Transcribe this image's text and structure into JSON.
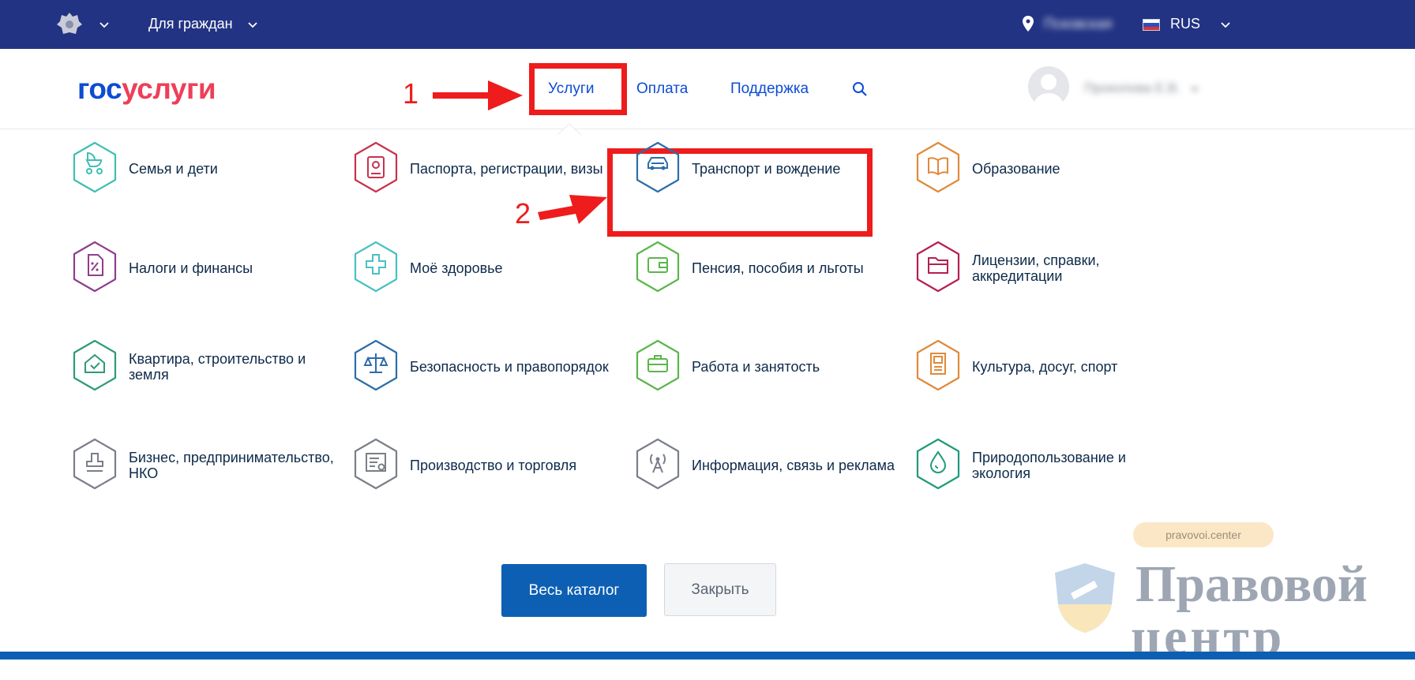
{
  "topbar": {
    "for_citizens": "Для граждан",
    "location": "Псковская",
    "language": "RUS"
  },
  "header": {
    "logo_part1": "гос",
    "logo_part2": "услуги",
    "nav": [
      "Услуги",
      "Оплата",
      "Поддержка"
    ],
    "user_name": "Прокопова Е.В."
  },
  "annotations": {
    "marker1": "1",
    "marker2": "2"
  },
  "catalog": {
    "items": [
      {
        "label": "Семья и дети",
        "icon": "stroller-icon",
        "color": "#3fbfb3"
      },
      {
        "label": "Паспорта, регистрации, визы",
        "icon": "passport-icon",
        "color": "#c8324c"
      },
      {
        "label": "Транспорт и вождение",
        "icon": "car-icon",
        "color": "#2d6da8"
      },
      {
        "label": "Образование",
        "icon": "book-icon",
        "color": "#e08a3a"
      },
      {
        "label": "Налоги и финансы",
        "icon": "tax-document-icon",
        "color": "#8f3e8d"
      },
      {
        "label": "Моё здоровье",
        "icon": "medical-cross-icon",
        "color": "#4ac1c0"
      },
      {
        "label": "Пенсия, пособия и льготы",
        "icon": "wallet-icon",
        "color": "#5bb64b"
      },
      {
        "label": "Лицензии, справки, аккредитации",
        "icon": "folder-icon",
        "color": "#b4204f"
      },
      {
        "label": "Квартира, строительство и земля",
        "icon": "house-icon",
        "color": "#2e9a7a"
      },
      {
        "label": "Безопасность и правопорядок",
        "icon": "scales-icon",
        "color": "#2d6da8"
      },
      {
        "label": "Работа и занятость",
        "icon": "briefcase-icon",
        "color": "#5bb64b"
      },
      {
        "label": "Культура, досуг, спорт",
        "icon": "culture-icon",
        "color": "#e08a3a"
      },
      {
        "label": "Бизнес, предпринимательство, НКО",
        "icon": "stamp-icon",
        "color": "#7a7f88"
      },
      {
        "label": "Производство и торговля",
        "icon": "certificate-icon",
        "color": "#7a7f88"
      },
      {
        "label": "Информация, связь и реклама",
        "icon": "antenna-icon",
        "color": "#7a7f88"
      },
      {
        "label": "Природопользование и экология",
        "icon": "drop-icon",
        "color": "#1f9a7a"
      }
    ]
  },
  "buttons": {
    "catalog": "Весь каталог",
    "close": "Закрыть"
  },
  "watermark": {
    "domain": "pravovoi.center",
    "line1": "Правовой",
    "line2": "центр"
  }
}
